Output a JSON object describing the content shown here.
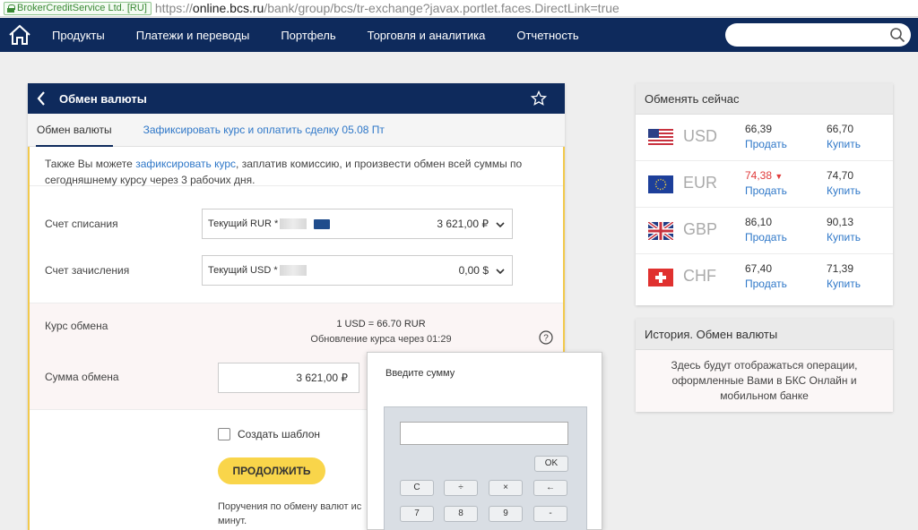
{
  "browser": {
    "cert_label": "BrokerCreditService Ltd. [RU]",
    "url_prefix": "https://",
    "url_domain": "online.bcs.ru",
    "url_path": "/bank/group/bcs/tr-exchange?javax.portlet.faces.DirectLink=true"
  },
  "nav": {
    "items": [
      "Продукты",
      "Платежи и переводы",
      "Портфель",
      "Торговля и аналитика",
      "Отчетность"
    ],
    "search_placeholder": ""
  },
  "card": {
    "title": "Обмен валюты",
    "tabs": [
      "Обмен валюты",
      "Зафиксировать курс и оплатить сделку 05.08 Пт"
    ],
    "info_before": "Также Вы можете ",
    "info_link": "зафиксировать курс",
    "info_after": ", заплатив комиссию, и произвести обмен всей суммы по сегодняшнему курсу через 3 рабочих дня.",
    "debit_label": "Счет списания",
    "debit_account": "Текущий RUR *",
    "debit_amount": "3 621,00 ₽",
    "credit_label": "Счет зачисления",
    "credit_account": "Текущий USD *",
    "credit_amount": "0,00 $",
    "rate_label": "Курс обмена",
    "rate_value": "1 USD = 66.70 RUR",
    "rate_update": "Обновление курса через 01:29",
    "sum_label": "Сумма обмена",
    "sum_value": "3 621,00 ₽",
    "template_label": "Создать шаблон",
    "continue_label": "ПРОДОЛЖИТЬ",
    "note": "Поручения по обмену валют ис минут."
  },
  "popup": {
    "title": "Введите сумму",
    "display_value": "",
    "ok": "OK",
    "row1": [
      "C",
      "÷",
      "×",
      "←"
    ],
    "row2": [
      "7",
      "8",
      "9",
      "-"
    ]
  },
  "exchange": {
    "title": "Обменять сейчас",
    "sell_label": "Продать",
    "buy_label": "Купить",
    "rows": [
      {
        "code": "USD",
        "sell": "66,39",
        "buy": "66,70"
      },
      {
        "code": "EUR",
        "sell": "74,38",
        "buy": "74,70"
      },
      {
        "code": "GBP",
        "sell": "86,10",
        "buy": "90,13"
      },
      {
        "code": "CHF",
        "sell": "67,40",
        "buy": "71,39"
      }
    ]
  },
  "history": {
    "title": "История. Обмен валюты",
    "body": "Здесь будут отображаться операции, оформленные Вами в БКС Онлайн и мобильном банке"
  },
  "colors": {
    "navy": "#0e2a5c",
    "link": "#2e77c8",
    "accent_yellow": "#f9d54a",
    "down_red": "#e03a3a"
  }
}
